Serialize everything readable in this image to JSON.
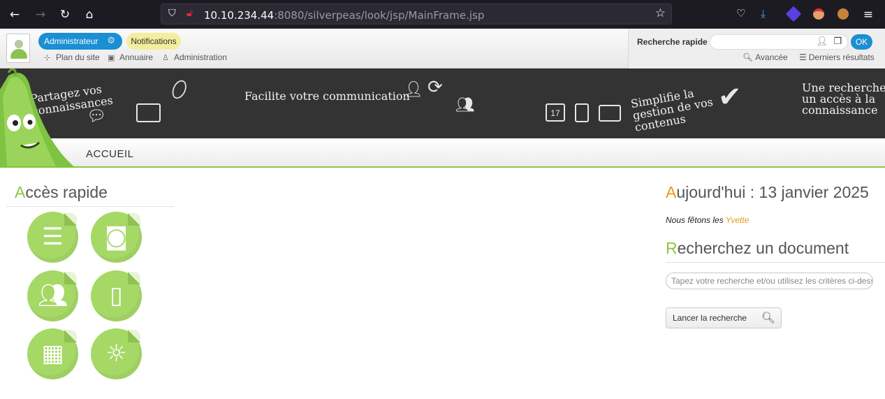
{
  "browser": {
    "url_host": "10.10.234.44",
    "url_rest": ":8080/silverpeas/look/jsp/MainFrame.jsp"
  },
  "header": {
    "user_pill": "Administrateur",
    "notifications": "Notifications",
    "links": [
      "Plan du site",
      "Annuaire",
      "Administration"
    ],
    "quick_search_label": "Recherche rapide",
    "ok_label": "OK",
    "advanced_label": "Avancée",
    "last_results_label": "Derniers résultats"
  },
  "banner": {
    "text1": "Partagez vos connaissances",
    "text2": "Facilite votre communication",
    "text3": "Simplifie la gestion de vos contenus",
    "text4": "Une recherche et un accès à la connaissance",
    "calendar_day": "17"
  },
  "menu": {
    "home": "ACCUEIL"
  },
  "quick_access": {
    "title_first": "A",
    "title_rest": "ccès rapide",
    "icons": [
      "books-icon",
      "camera-icon",
      "group-icon",
      "clipboard-icon",
      "map-icon",
      "lightbulb-icon"
    ]
  },
  "today": {
    "title_first": "A",
    "title_rest": "ujourd'hui : 13 janvier 2025",
    "feast_prefix": "Nous fêtons les ",
    "feast_name": "Yvette"
  },
  "doc_search": {
    "title_first": "R",
    "title_rest": "echerchez un document",
    "placeholder": "Tapez votre recherche et/ou utilisez les critères ci-dessous",
    "button": "Lancer la recherche"
  },
  "colors": {
    "accent_green": "#8dc63f",
    "accent_orange": "#e99b10",
    "pill_blue": "#1a8fd3",
    "banner_dark": "#333333"
  }
}
